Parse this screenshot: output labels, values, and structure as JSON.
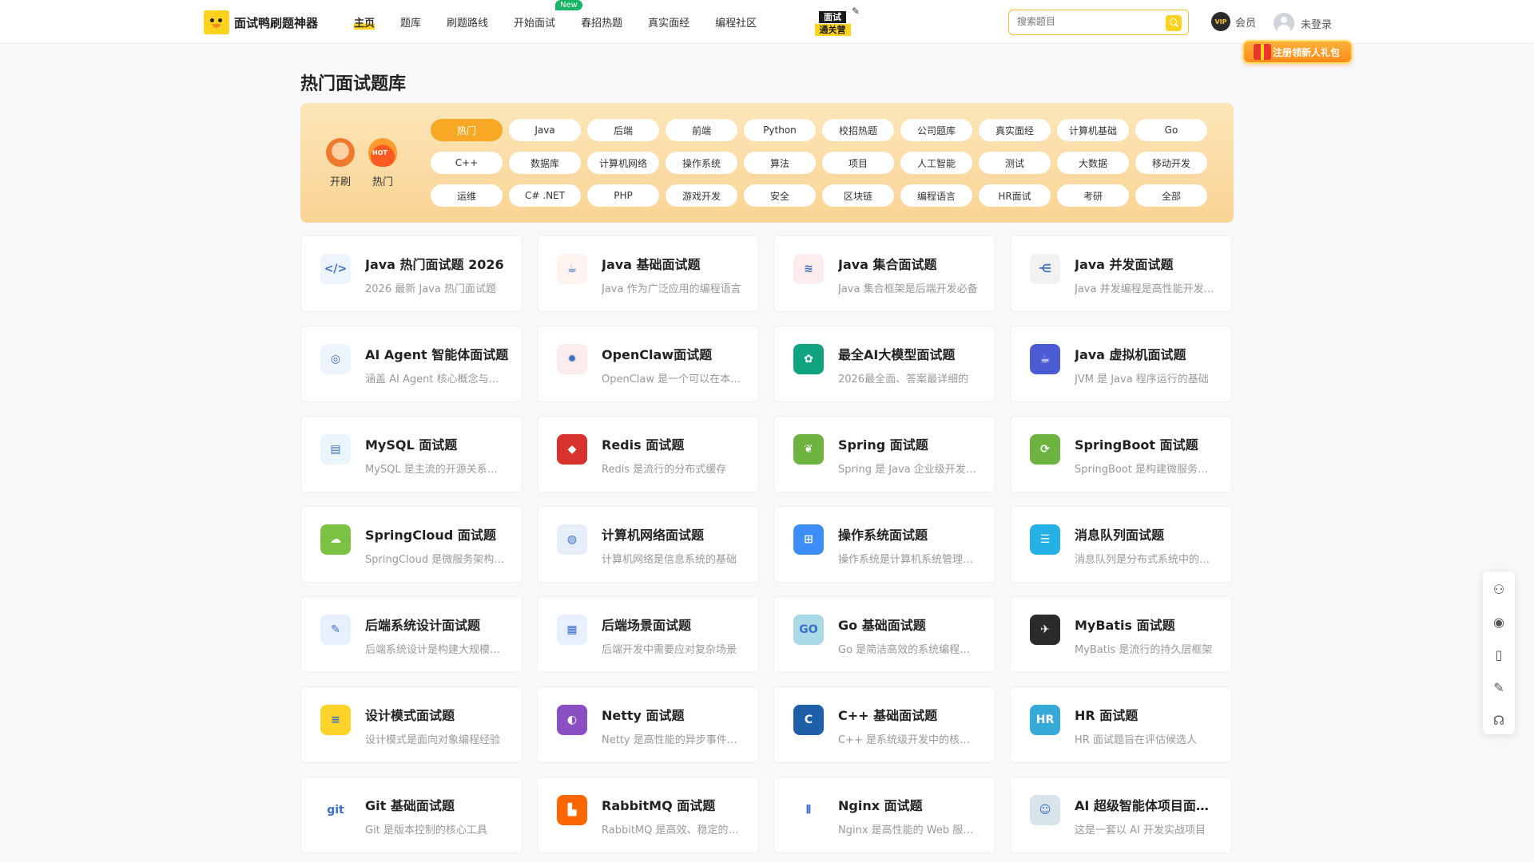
{
  "header": {
    "logo_text": "面试鸭刷题神器",
    "nav": [
      "主页",
      "题库",
      "刷题路线",
      "开始面试",
      "春招热题",
      "真实面经",
      "编程社区"
    ],
    "new_badge": "New",
    "promo_top": "面试",
    "promo_bottom": "通关营",
    "search_placeholder": "搜索题目",
    "vip_label": "会员",
    "vip_icon_text": "VIP",
    "login_label": "未登录",
    "gift_label": "注册领新人礼包"
  },
  "page_title": "热门面试题库",
  "quick_entries": [
    {
      "label": "开刷",
      "icon": "start-icon"
    },
    {
      "label": "热门",
      "icon": "hot-icon",
      "icon_text": "HOT"
    }
  ],
  "tags": [
    "热门",
    "Java",
    "后端",
    "前端",
    "Python",
    "校招热题",
    "公司题库",
    "真实面经",
    "计算机基础",
    "Go",
    "C++",
    "数据库",
    "计算机网络",
    "操作系统",
    "算法",
    "项目",
    "人工智能",
    "测试",
    "大数据",
    "移动开发",
    "运维",
    "C# .NET",
    "PHP",
    "游戏开发",
    "安全",
    "区块链",
    "编程语言",
    "HR面试",
    "考研",
    "全部"
  ],
  "active_tag": "热门",
  "cards": [
    {
      "title": "Java 热门面试题 2026",
      "desc": "2026 最新 Java 热门面试题",
      "icon": "code-window-icon",
      "color": "#eef4fb",
      "glyph": "</>"
    },
    {
      "title": "Java 基础面试题",
      "desc": "Java 作为广泛应用的编程语言",
      "icon": "java-cup-icon",
      "color": "#fff4ef",
      "glyph": "☕"
    },
    {
      "title": "Java 集合面试题",
      "desc": "Java 集合框架是后端开发必备",
      "icon": "layers-icon",
      "color": "#fdecec",
      "glyph": "≋"
    },
    {
      "title": "Java 并发面试题",
      "desc": "Java 并发编程是高性能开发核心",
      "icon": "branch-icon",
      "color": "#f1f1f1",
      "glyph": "⋲"
    },
    {
      "title": "AI Agent 智能体面试题",
      "desc": "涵盖 AI Agent 核心概念与实践",
      "icon": "ai-eye-icon",
      "color": "#eef4fb",
      "glyph": "◎"
    },
    {
      "title": "OpenClaw面试题",
      "desc": "OpenClaw 是一个可以在本地运行的",
      "icon": "crab-icon",
      "color": "#fdecec",
      "glyph": "✹"
    },
    {
      "title": "最全AI大模型面试题",
      "desc": "2026最全面、答案最详细的",
      "icon": "openai-icon",
      "color": "#10a37f",
      "glyph": "✿"
    },
    {
      "title": "Java 虚拟机面试题",
      "desc": "JVM 是 Java 程序运行的基础",
      "icon": "jvm-icon",
      "color": "#4b5bd4",
      "glyph": "☕"
    },
    {
      "title": "MySQL 面试题",
      "desc": "MySQL 是主流的开源关系型数据库",
      "icon": "mysql-icon",
      "color": "#eaf4fb",
      "glyph": "▤"
    },
    {
      "title": "Redis 面试题",
      "desc": "Redis 是流行的分布式缓存",
      "icon": "redis-icon",
      "color": "#d7322b",
      "glyph": "◆"
    },
    {
      "title": "Spring 面试题",
      "desc": "Spring 是 Java 企业级开发框架",
      "icon": "spring-leaf-icon",
      "color": "#6db33f",
      "glyph": "❦"
    },
    {
      "title": "SpringBoot 面试题",
      "desc": "SpringBoot 是构建微服务的框架",
      "icon": "springboot-icon",
      "color": "#6db33f",
      "glyph": "⟳"
    },
    {
      "title": "SpringCloud 面试题",
      "desc": "SpringCloud 是微服务架构方案",
      "icon": "cloud-leaf-icon",
      "color": "#7cc242",
      "glyph": "☁"
    },
    {
      "title": "计算机网络面试题",
      "desc": "计算机网络是信息系统的基础",
      "icon": "network-globe-icon",
      "color": "#e6eefa",
      "glyph": "◍"
    },
    {
      "title": "操作系统面试题",
      "desc": "操作系统是计算机系统管理核心",
      "icon": "windows-icon",
      "color": "#3d8ef8",
      "glyph": "⊞"
    },
    {
      "title": "消息队列面试题",
      "desc": "消息队列是分布式系统中的组件",
      "icon": "message-queue-icon",
      "color": "#24b2e6",
      "glyph": "☰"
    },
    {
      "title": "后端系统设计面试题",
      "desc": "后端系统设计是构建大规模系统",
      "icon": "design-tools-icon",
      "color": "#e8efff",
      "glyph": "✎"
    },
    {
      "title": "后端场景面试题",
      "desc": "后端开发中需要应对复杂场景",
      "icon": "grid-icon",
      "color": "#e8efff",
      "glyph": "▦"
    },
    {
      "title": "Go 基础面试题",
      "desc": "Go 是简洁高效的系统编程语言",
      "icon": "go-icon",
      "color": "#a9d8e6",
      "glyph": "GO"
    },
    {
      "title": "MyBatis 面试题",
      "desc": "MyBatis 是流行的持久层框架",
      "icon": "mybatis-bird-icon",
      "color": "#2b2b2b",
      "glyph": "✈"
    },
    {
      "title": "设计模式面试题",
      "desc": "设计模式是面向对象编程经验",
      "icon": "notepad-icon",
      "color": "#ffd42a",
      "glyph": "≡"
    },
    {
      "title": "Netty 面试题",
      "desc": "Netty 是高性能的异步事件框架",
      "icon": "netty-icon",
      "color": "#8a4fc2",
      "glyph": "◐"
    },
    {
      "title": "C++ 基础面试题",
      "desc": "C++ 是系统级开发中的核心语言",
      "icon": "cpp-icon",
      "color": "#1f5fa8",
      "glyph": "C"
    },
    {
      "title": "HR 面试题",
      "desc": "HR 面试题旨在评估候选人",
      "icon": "hr-person-icon",
      "color": "#35a9d8",
      "glyph": "HR"
    },
    {
      "title": "Git 基础面试题",
      "desc": "Git 是版本控制的核心工具",
      "icon": "git-icon",
      "color": "#ffffff",
      "glyph": "git"
    },
    {
      "title": "RabbitMQ 面试题",
      "desc": "RabbitMQ 是高效、稳定的消息队列",
      "icon": "rabbitmq-icon",
      "color": "#ff6600",
      "glyph": "▙"
    },
    {
      "title": "Nginx 面试题",
      "desc": "Nginx 是高性能的 Web 服务器",
      "icon": "nginx-icon",
      "color": "#ffffff",
      "glyph": "⫴"
    },
    {
      "title": "AI 超级智能体项目面试题",
      "desc": "这是一套以 AI 开发实战项目",
      "icon": "robot-icon",
      "color": "#d7e4ea",
      "glyph": "☺"
    }
  ],
  "side_tools": [
    {
      "icon": "feedback-person-icon",
      "glyph": "⚇"
    },
    {
      "icon": "wechat-icon",
      "glyph": "◉"
    },
    {
      "icon": "mobile-icon",
      "glyph": "▯"
    },
    {
      "icon": "edit-pen-icon",
      "glyph": "✎"
    },
    {
      "icon": "headset-icon",
      "glyph": "☊"
    }
  ]
}
